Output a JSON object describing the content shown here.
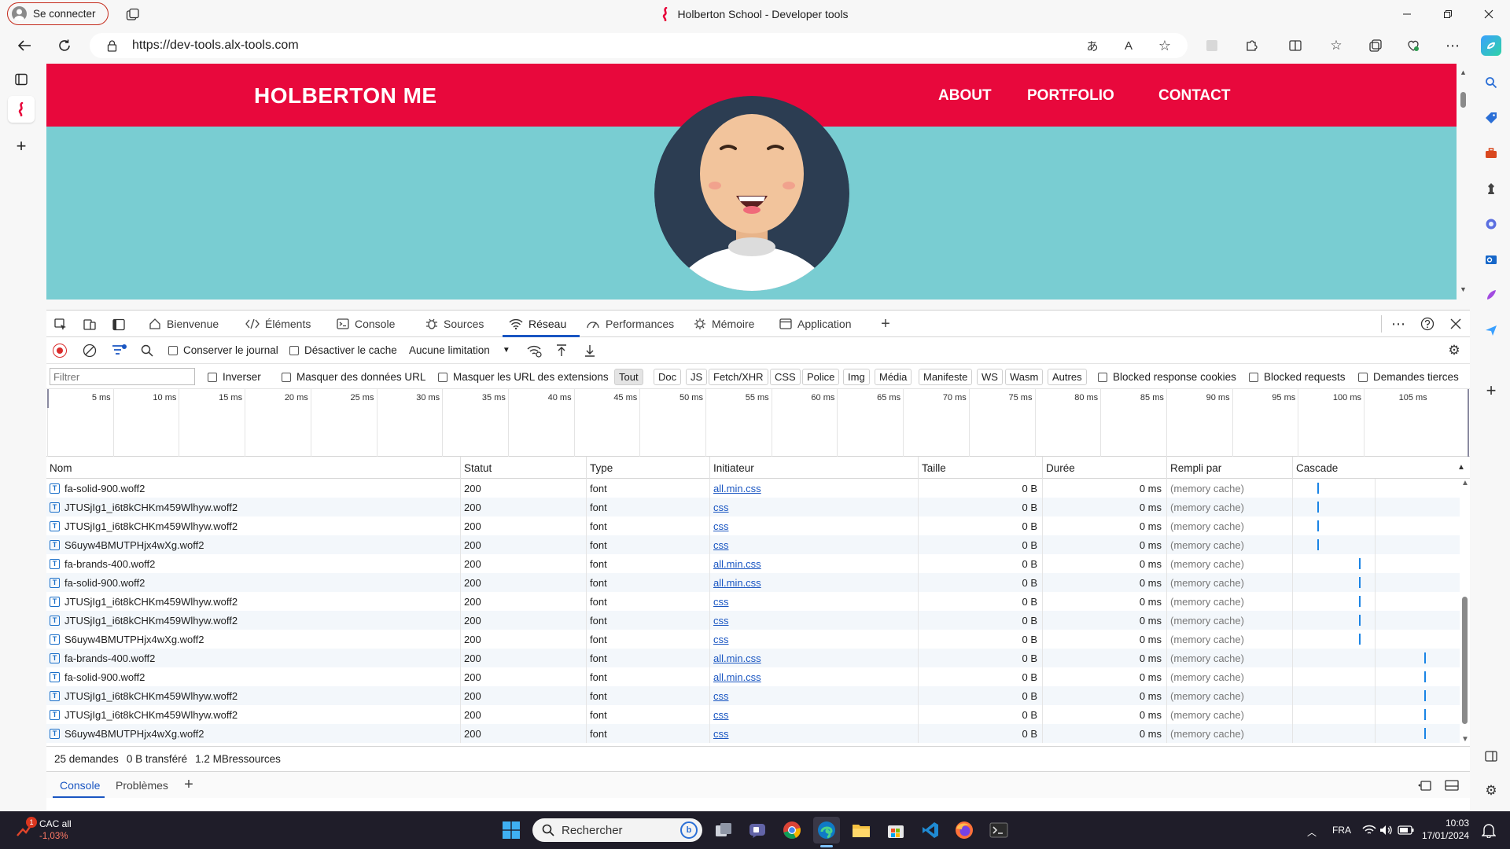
{
  "browser": {
    "signin_label": "Se connecter",
    "window_title": "Holberton School - Developer tools",
    "url": "https://dev-tools.alx-tools.com"
  },
  "site": {
    "logo": "HOLBERTON ME",
    "nav": [
      "ABOUT",
      "PORTFOLIO",
      "CONTACT"
    ]
  },
  "devtools": {
    "tabs": [
      {
        "label": "Bienvenue",
        "icon": "home-icon"
      },
      {
        "label": "Éléments",
        "icon": "code-icon"
      },
      {
        "label": "Console",
        "icon": "console-icon"
      },
      {
        "label": "Sources",
        "icon": "bug-icon"
      },
      {
        "label": "Réseau",
        "icon": "wifi-icon",
        "active": true
      },
      {
        "label": "Performances",
        "icon": "gauge-icon"
      },
      {
        "label": "Mémoire",
        "icon": "chip-icon"
      },
      {
        "label": "Application",
        "icon": "window-icon"
      }
    ],
    "toolbar": {
      "preserve_log": "Conserver le journal",
      "disable_cache": "Désactiver le cache",
      "throttling": "Aucune limitation"
    },
    "filter": {
      "placeholder": "Filtrer",
      "invert": "Inverser",
      "hide_data_urls": "Masquer des données URL",
      "hide_ext_urls": "Masquer les URL des extensions",
      "types": [
        "Tout",
        "Doc",
        "JS",
        "Fetch/XHR",
        "CSS",
        "Police",
        "Img",
        "Média",
        "Manifeste",
        "WS",
        "Wasm",
        "Autres"
      ],
      "selected_type": "Tout",
      "blocked_cookies": "Blocked response cookies",
      "blocked_requests": "Blocked requests",
      "third_party": "Demandes tierces"
    },
    "timeline_ticks": [
      "5 ms",
      "10 ms",
      "15 ms",
      "20 ms",
      "25 ms",
      "30 ms",
      "35 ms",
      "40 ms",
      "45 ms",
      "50 ms",
      "55 ms",
      "60 ms",
      "65 ms",
      "70 ms",
      "75 ms",
      "80 ms",
      "85 ms",
      "90 ms",
      "95 ms",
      "100 ms",
      "105 ms"
    ],
    "columns": [
      "Nom",
      "Statut",
      "Type",
      "Initiateur",
      "Taille",
      "Durée",
      "Rempli par",
      "Cascade"
    ],
    "rows": [
      {
        "name": "fa-solid-900.woff2",
        "status": "200",
        "type": "font",
        "initiator": "all.min.css",
        "size": "0 B",
        "time": "0 ms",
        "fulfilled": "(memory cache)",
        "wf": 0.16
      },
      {
        "name": "JTUSjIg1_i6t8kCHKm459Wlhyw.woff2",
        "status": "200",
        "type": "font",
        "initiator": "css",
        "size": "0 B",
        "time": "0 ms",
        "fulfilled": "(memory cache)",
        "wf": 0.16
      },
      {
        "name": "JTUSjIg1_i6t8kCHKm459Wlhyw.woff2",
        "status": "200",
        "type": "font",
        "initiator": "css",
        "size": "0 B",
        "time": "0 ms",
        "fulfilled": "(memory cache)",
        "wf": 0.16
      },
      {
        "name": "S6uyw4BMUTPHjx4wXg.woff2",
        "status": "200",
        "type": "font",
        "initiator": "css",
        "size": "0 B",
        "time": "0 ms",
        "fulfilled": "(memory cache)",
        "wf": 0.16
      },
      {
        "name": "fa-brands-400.woff2",
        "status": "200",
        "type": "font",
        "initiator": "all.min.css",
        "size": "0 B",
        "time": "0 ms",
        "fulfilled": "(memory cache)",
        "wf": 0.48
      },
      {
        "name": "fa-solid-900.woff2",
        "status": "200",
        "type": "font",
        "initiator": "all.min.css",
        "size": "0 B",
        "time": "0 ms",
        "fulfilled": "(memory cache)",
        "wf": 0.48
      },
      {
        "name": "JTUSjIg1_i6t8kCHKm459Wlhyw.woff2",
        "status": "200",
        "type": "font",
        "initiator": "css",
        "size": "0 B",
        "time": "0 ms",
        "fulfilled": "(memory cache)",
        "wf": 0.48
      },
      {
        "name": "JTUSjIg1_i6t8kCHKm459Wlhyw.woff2",
        "status": "200",
        "type": "font",
        "initiator": "css",
        "size": "0 B",
        "time": "0 ms",
        "fulfilled": "(memory cache)",
        "wf": 0.48
      },
      {
        "name": "S6uyw4BMUTPHjx4wXg.woff2",
        "status": "200",
        "type": "font",
        "initiator": "css",
        "size": "0 B",
        "time": "0 ms",
        "fulfilled": "(memory cache)",
        "wf": 0.48
      },
      {
        "name": "fa-brands-400.woff2",
        "status": "200",
        "type": "font",
        "initiator": "all.min.css",
        "size": "0 B",
        "time": "0 ms",
        "fulfilled": "(memory cache)",
        "wf": 0.98
      },
      {
        "name": "fa-solid-900.woff2",
        "status": "200",
        "type": "font",
        "initiator": "all.min.css",
        "size": "0 B",
        "time": "0 ms",
        "fulfilled": "(memory cache)",
        "wf": 0.98
      },
      {
        "name": "JTUSjIg1_i6t8kCHKm459Wlhyw.woff2",
        "status": "200",
        "type": "font",
        "initiator": "css",
        "size": "0 B",
        "time": "0 ms",
        "fulfilled": "(memory cache)",
        "wf": 0.98
      },
      {
        "name": "JTUSjIg1_i6t8kCHKm459Wlhyw.woff2",
        "status": "200",
        "type": "font",
        "initiator": "css",
        "size": "0 B",
        "time": "0 ms",
        "fulfilled": "(memory cache)",
        "wf": 0.98
      },
      {
        "name": "S6uyw4BMUTPHjx4wXg.woff2",
        "status": "200",
        "type": "font",
        "initiator": "css",
        "size": "0 B",
        "time": "0 ms",
        "fulfilled": "(memory cache)",
        "wf": 0.98
      }
    ],
    "status": {
      "requests": "25 demandes",
      "transferred": "0 B transféré",
      "resources": "1.2 MBressources"
    },
    "drawer_tabs": [
      "Console",
      "Problèmes"
    ]
  },
  "taskbar": {
    "stock_name": "CAC all",
    "stock_change": "-1,03%",
    "stock_badge": "1",
    "search_placeholder": "Rechercher",
    "lang": "FRA",
    "time": "10:03",
    "date": "17/01/2024"
  },
  "colors": {
    "site_header": "#e8083c",
    "site_bg": "#79cdd2",
    "link": "#1a56c2",
    "record": "#d92b2b",
    "taskbar": "#1f1d29"
  }
}
